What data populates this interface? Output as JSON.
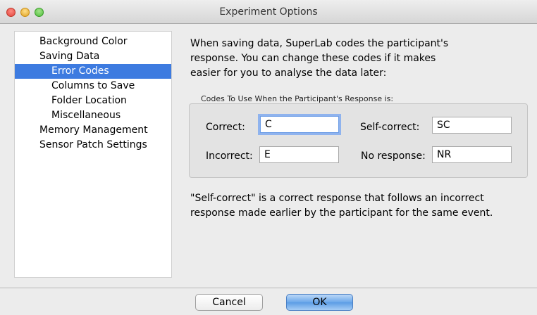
{
  "window": {
    "title": "Experiment Options"
  },
  "sidebar": {
    "items": [
      {
        "label": "Background Color",
        "level": 0,
        "selected": false
      },
      {
        "label": "Saving Data",
        "level": 0,
        "selected": false
      },
      {
        "label": "Error Codes",
        "level": 1,
        "selected": true
      },
      {
        "label": "Columns to Save",
        "level": 1,
        "selected": false
      },
      {
        "label": "Folder Location",
        "level": 1,
        "selected": false
      },
      {
        "label": "Miscellaneous",
        "level": 1,
        "selected": false
      },
      {
        "label": "Memory Management",
        "level": 0,
        "selected": false
      },
      {
        "label": "Sensor Patch Settings",
        "level": 0,
        "selected": false
      }
    ]
  },
  "main": {
    "intro_lines": [
      "When saving data, SuperLab codes the participant's",
      "response.  You can change these codes if it makes",
      "easier for you to analyse the data later:"
    ],
    "group_label": "Codes To Use When the Participant's Response is:",
    "fields": {
      "correct": {
        "label": "Correct:",
        "value": "C"
      },
      "incorrect": {
        "label": "Incorrect:",
        "value": "E"
      },
      "self_correct": {
        "label": "Self-correct:",
        "value": "SC"
      },
      "no_response": {
        "label": "No response:",
        "value": "NR"
      }
    },
    "note_lines": [
      "\"Self-correct\" is a correct response that follows an incorrect",
      "response made earlier by the participant for the same event."
    ]
  },
  "buttons": {
    "cancel": "Cancel",
    "ok": "OK"
  },
  "colors": {
    "selection": "#3d7be0",
    "default_button": "#6aa7ea",
    "focus_ring": "#8fb3ee"
  }
}
